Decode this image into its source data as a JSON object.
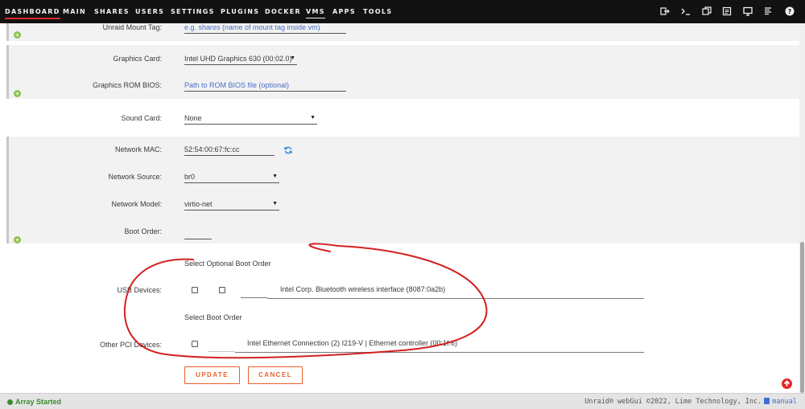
{
  "nav": {
    "items": [
      "DASHBOARD",
      "MAIN",
      "SHARES",
      "USERS",
      "SETTINGS",
      "PLUGINS",
      "DOCKER",
      "VMS",
      "APPS",
      "TOOLS"
    ],
    "active_index": 0,
    "current_index": 7,
    "icons": [
      "logout-icon",
      "terminal-icon",
      "copy-window-icon",
      "log-icon",
      "monitor-icon",
      "feedback-icon",
      "help-icon"
    ]
  },
  "form": {
    "mount_tag": {
      "label": "Unraid Mount Tag:",
      "placeholder": "e.g. shares (name of mount tag inside vm)"
    },
    "graphics_card": {
      "label": "Graphics Card:",
      "value": "Intel UHD Graphics 630 (00:02.0)"
    },
    "graphics_rom": {
      "label": "Graphics ROM BIOS:",
      "placeholder": "Path to ROM BIOS file (optional)"
    },
    "sound_card": {
      "label": "Sound Card:",
      "value": "None"
    },
    "network_mac": {
      "label": "Network MAC:",
      "value": "52:54:00:67:fc:cc"
    },
    "network_source": {
      "label": "Network Source:",
      "value": "br0"
    },
    "network_model": {
      "label": "Network Model:",
      "value": "virtio-net"
    },
    "boot_order": {
      "label": "Boot Order:",
      "value": ""
    },
    "usb": {
      "header": "Select  Optional  Boot Order",
      "label": "USB Devices:",
      "device": "Intel Corp. Bluetooth wireless interface (8087:0a2b)"
    },
    "pci": {
      "header": "Select  Boot Order",
      "label": "Other PCI Devices:",
      "device": "Intel Ethernet Connection (2) I219-V | Ethernet controller (00:1f.6)"
    }
  },
  "buttons": {
    "update": "UPDATE",
    "cancel": "CANCEL"
  },
  "footer": {
    "status": "Array Started",
    "copyright": "Unraid® webGui ©2022, Lime Technology, Inc.",
    "manual": "manual"
  },
  "colors": {
    "accent": "#e8622d",
    "nav_bg": "#121212",
    "status_green": "#3d8b2f",
    "annotation_red": "#d42020",
    "link_blue": "#4a6ec8"
  }
}
